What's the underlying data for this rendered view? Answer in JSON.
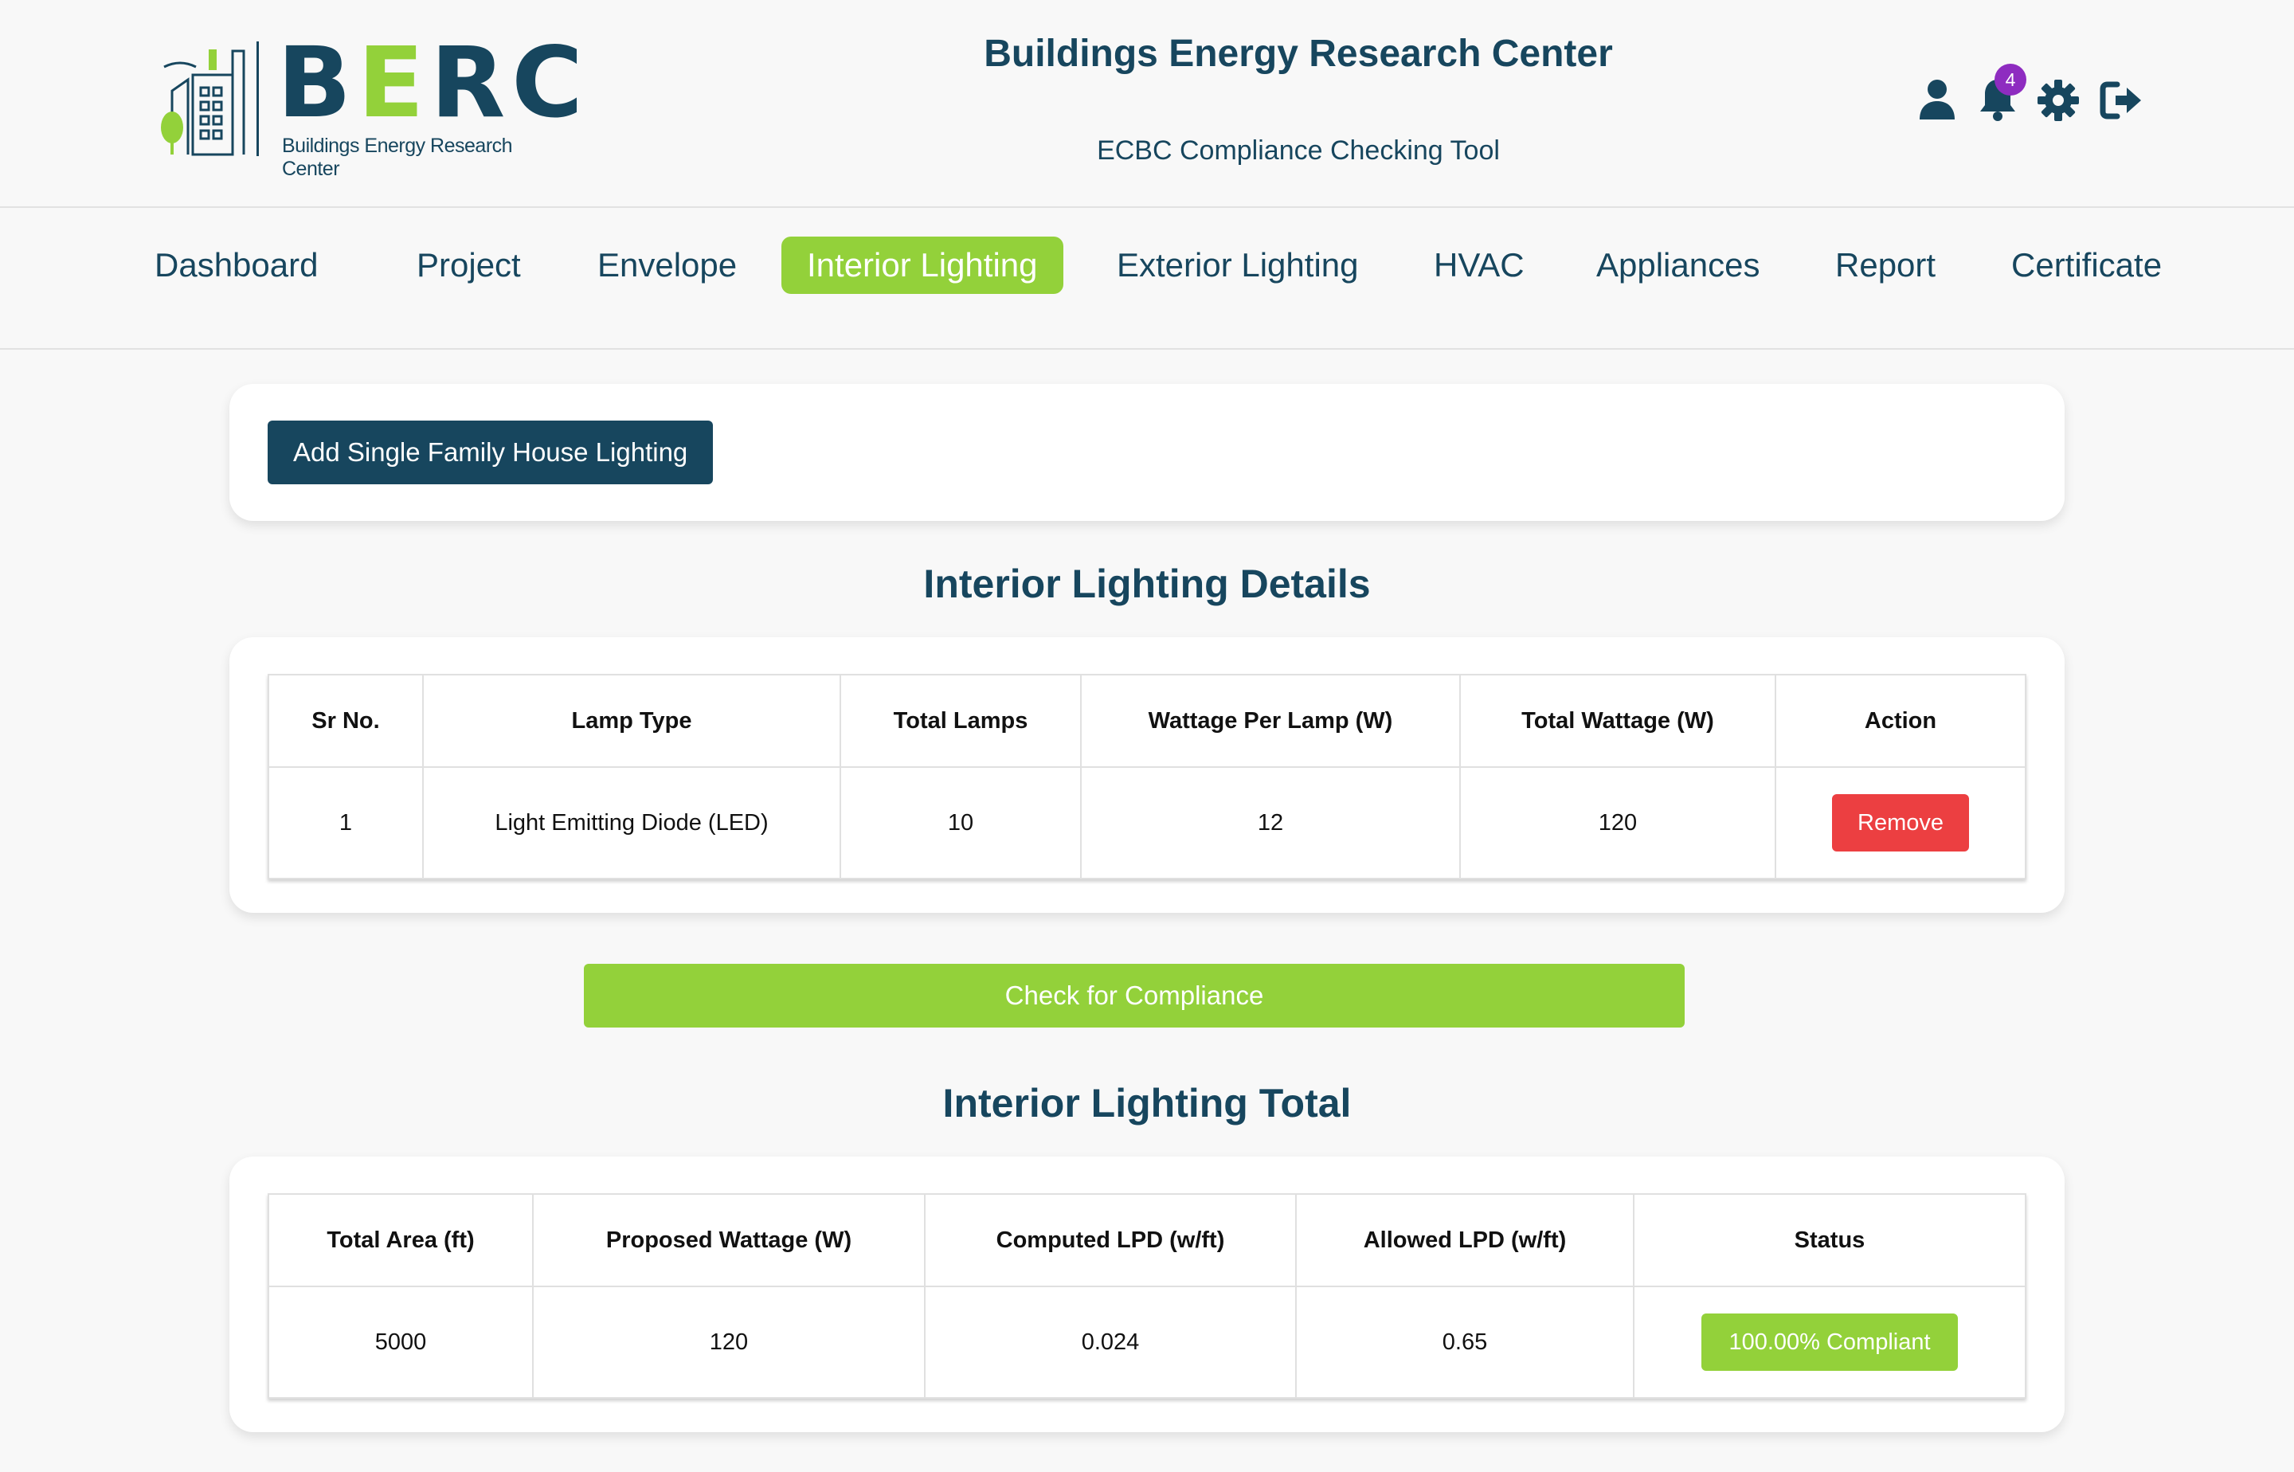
{
  "header": {
    "logo_text_b": "B",
    "logo_text_e": "E",
    "logo_text_rc": "RC",
    "logo_subtitle": "Buildings Energy Research Center",
    "title": "Buildings Energy Research Center",
    "subtitle": "ECBC Compliance Checking Tool",
    "notification_count": "4",
    "icons": [
      "user-icon",
      "bell-icon",
      "gear-icon",
      "logout-icon"
    ]
  },
  "nav": {
    "items": [
      "Dashboard",
      "Project",
      "Envelope",
      "Interior Lighting",
      "Exterior Lighting",
      "HVAC",
      "Appliances",
      "Report",
      "Certificate"
    ],
    "active": "Interior Lighting"
  },
  "actions": {
    "add_button": "Add Single Family House Lighting",
    "check_button": "Check for Compliance"
  },
  "details": {
    "title": "Interior Lighting Details",
    "headers": [
      "Sr No.",
      "Lamp Type",
      "Total Lamps",
      "Wattage Per Lamp (W)",
      "Total Wattage (W)",
      "Action"
    ],
    "rows": [
      {
        "sr": "1",
        "lamp_type": "Light Emitting Diode (LED)",
        "total_lamps": "10",
        "wattage_per_lamp": "12",
        "total_wattage": "120",
        "action": "Remove"
      }
    ]
  },
  "totals": {
    "title": "Interior Lighting Total",
    "headers": [
      "Total Area (ft)",
      "Proposed Wattage (W)",
      "Computed LPD (w/ft)",
      "Allowed LPD (w/ft)",
      "Status"
    ],
    "row": {
      "area": "5000",
      "proposed": "120",
      "computed": "0.024",
      "allowed": "0.65",
      "status": "100.00% Compliant"
    }
  },
  "colors": {
    "primary": "#17465e",
    "accent_green": "#93d13a",
    "danger": "#ec3f41",
    "badge": "#8e2cc0"
  }
}
